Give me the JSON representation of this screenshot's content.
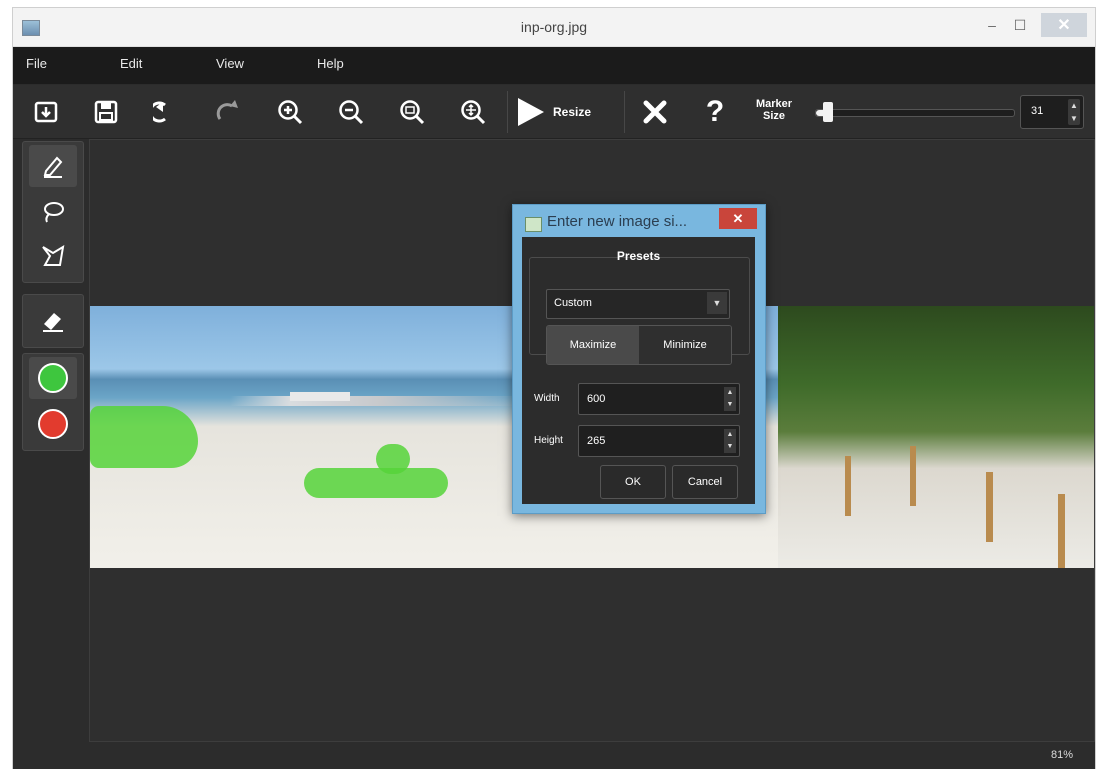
{
  "window": {
    "title": "inp-org.jpg"
  },
  "menu": {
    "items": [
      "File",
      "Edit",
      "View",
      "Help"
    ]
  },
  "toolbar": {
    "icons": [
      "open-icon",
      "save-icon",
      "undo-icon",
      "redo-icon",
      "zoom-in-icon",
      "zoom-out-icon",
      "zoom-fit-icon",
      "zoom-actual-icon"
    ],
    "resize_label": "Resize",
    "marker_label_line1": "Marker",
    "marker_label_line2": "Size",
    "marker_value": "31",
    "marker_fraction": 0.06
  },
  "sidebar": {
    "tools": [
      "marker-icon",
      "lasso-icon",
      "polygon-icon",
      "eraser-icon",
      "keep-color-icon",
      "remove-color-icon"
    ],
    "colors": {
      "keep": "#3ec63e",
      "remove": "#e23b2e"
    }
  },
  "dialog": {
    "title": "Enter new image si...",
    "presets_title": "Presets",
    "preset_selected": "Custom",
    "maximize_label": "Maximize",
    "minimize_label": "Minimize",
    "width_label": "Width",
    "width_value": "600",
    "height_label": "Height",
    "height_value": "265",
    "ok_label": "OK",
    "cancel_label": "Cancel"
  },
  "status": {
    "zoom": "81%"
  },
  "colors": {
    "accent": "#79b7df",
    "mask": "#56d33a",
    "close": "#c9453b"
  }
}
